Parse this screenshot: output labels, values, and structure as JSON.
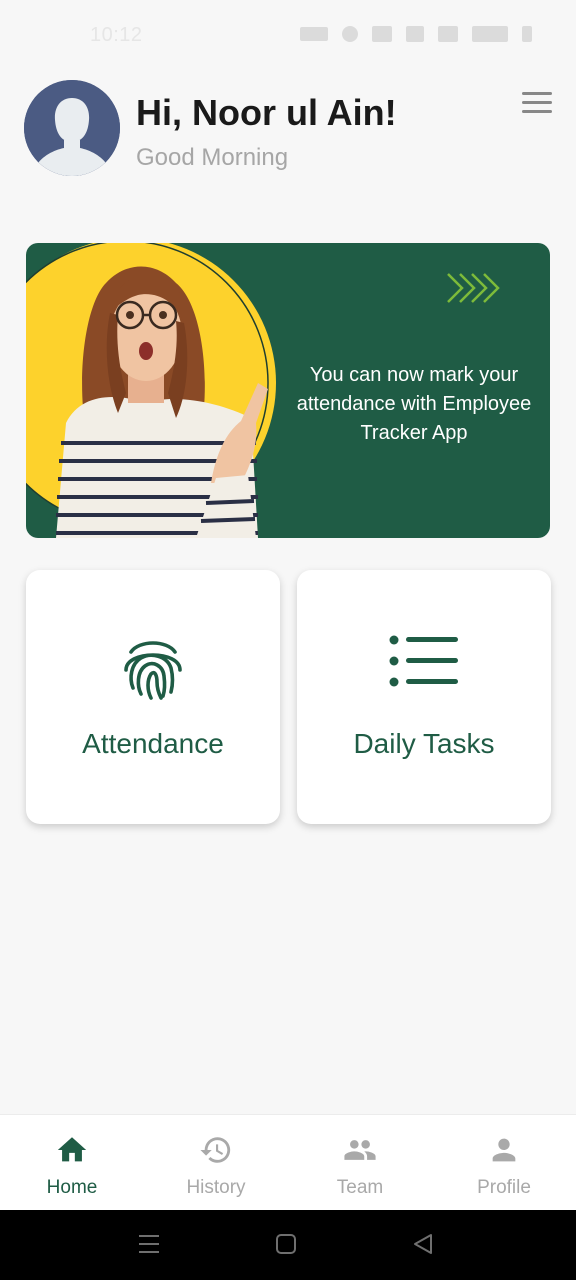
{
  "status_bar": {
    "time": "10:12"
  },
  "header": {
    "greeting": "Hi, Noor ul Ain!",
    "subgreeting": "Good Morning",
    "avatar_icon": "user-silhouette-icon",
    "menu_icon": "hamburger-menu-icon"
  },
  "banner": {
    "text": "You can now mark your attendance with Employee Tracker App",
    "background_color": "#1f5c45",
    "accent_color": "#fdd22c"
  },
  "cards": [
    {
      "label": "Attendance",
      "icon": "fingerprint-icon"
    },
    {
      "label": "Daily Tasks",
      "icon": "list-icon"
    }
  ],
  "bottom_nav": {
    "items": [
      {
        "label": "Home",
        "icon": "home-icon",
        "active": true
      },
      {
        "label": "History",
        "icon": "history-icon",
        "active": false
      },
      {
        "label": "Team",
        "icon": "team-icon",
        "active": false
      },
      {
        "label": "Profile",
        "icon": "profile-icon",
        "active": false
      }
    ],
    "active_color": "#1f5c45",
    "inactive_color": "#a9a9a9"
  },
  "system_nav": {
    "buttons": [
      "recents-icon",
      "home-square-icon",
      "back-triangle-icon"
    ]
  }
}
